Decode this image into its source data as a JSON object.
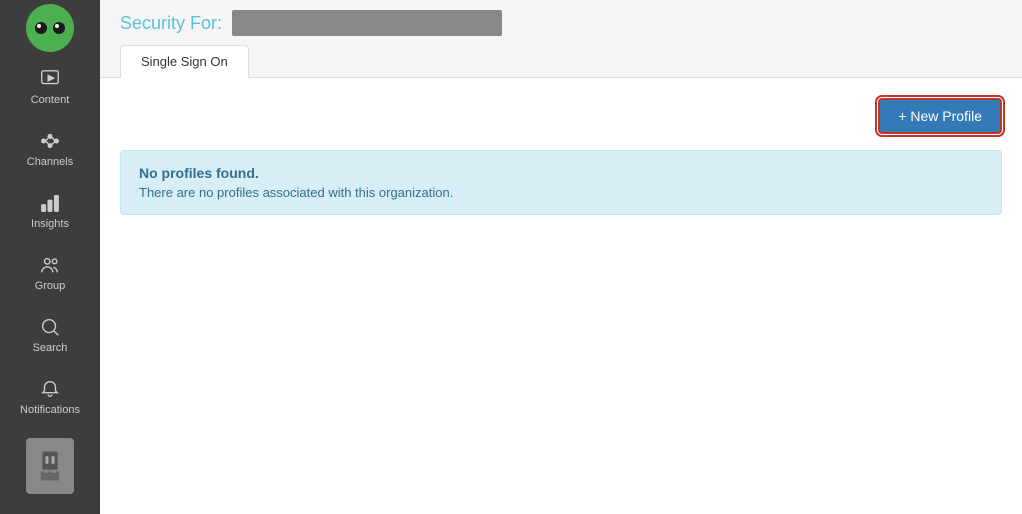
{
  "sidebar": {
    "items": [
      {
        "id": "content",
        "label": "Content",
        "icon": "play-icon"
      },
      {
        "id": "channels",
        "label": "Channels",
        "icon": "channels-icon"
      },
      {
        "id": "insights",
        "label": "Insights",
        "icon": "insights-icon"
      },
      {
        "id": "group",
        "label": "Group",
        "icon": "group-icon"
      },
      {
        "id": "search",
        "label": "Search",
        "icon": "search-icon"
      },
      {
        "id": "notifications",
        "label": "Notifications",
        "icon": "bell-icon"
      }
    ]
  },
  "header": {
    "security_for_label": "Security For:",
    "security_for_value": ""
  },
  "tabs": [
    {
      "id": "sso",
      "label": "Single Sign On",
      "active": true
    }
  ],
  "toolbar": {
    "new_profile_label": "+ New Profile"
  },
  "alert": {
    "title": "No profiles found.",
    "body": "There are no profiles associated with this organization."
  }
}
